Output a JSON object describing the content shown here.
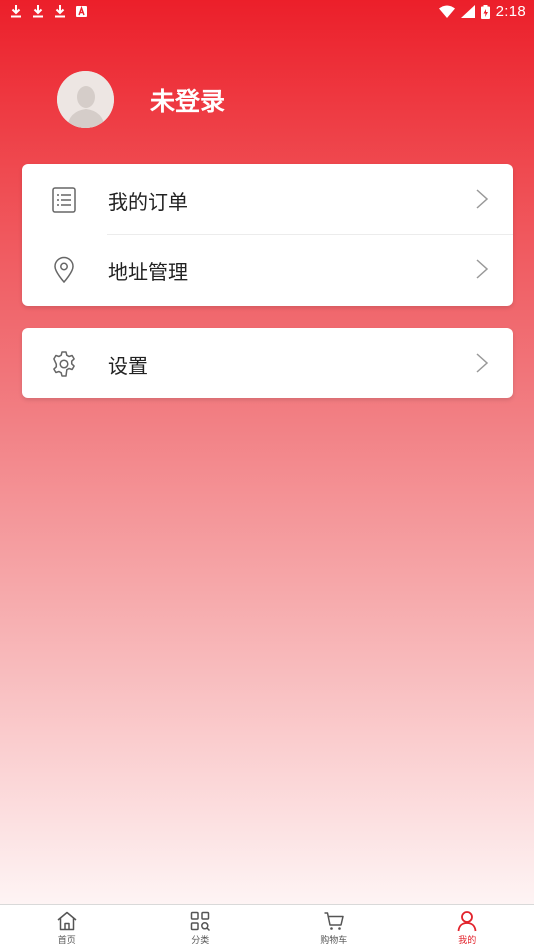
{
  "status_bar": {
    "time": "2:18",
    "left_icons": [
      "download-icon",
      "download-icon",
      "download-icon",
      "a-icon"
    ],
    "right_icons": [
      "wifi-icon",
      "signal-icon",
      "battery-icon"
    ]
  },
  "profile": {
    "name": "未登录",
    "avatar": "default-avatar"
  },
  "menu_card_1": {
    "items": [
      {
        "label": "我的订单",
        "icon": "order-list-icon"
      },
      {
        "label": "地址管理",
        "icon": "location-pin-icon"
      }
    ]
  },
  "menu_card_2": {
    "items": [
      {
        "label": "设置",
        "icon": "gear-icon"
      }
    ]
  },
  "tabbar": {
    "tabs": [
      {
        "label": "首页",
        "icon": "home-icon",
        "active": false
      },
      {
        "label": "分类",
        "icon": "category-icon",
        "active": false
      },
      {
        "label": "购物车",
        "icon": "cart-icon",
        "active": false
      },
      {
        "label": "我的",
        "icon": "user-icon",
        "active": true
      }
    ]
  },
  "colors": {
    "accent": "#e2222b",
    "header_top": "#ec1f2a"
  }
}
